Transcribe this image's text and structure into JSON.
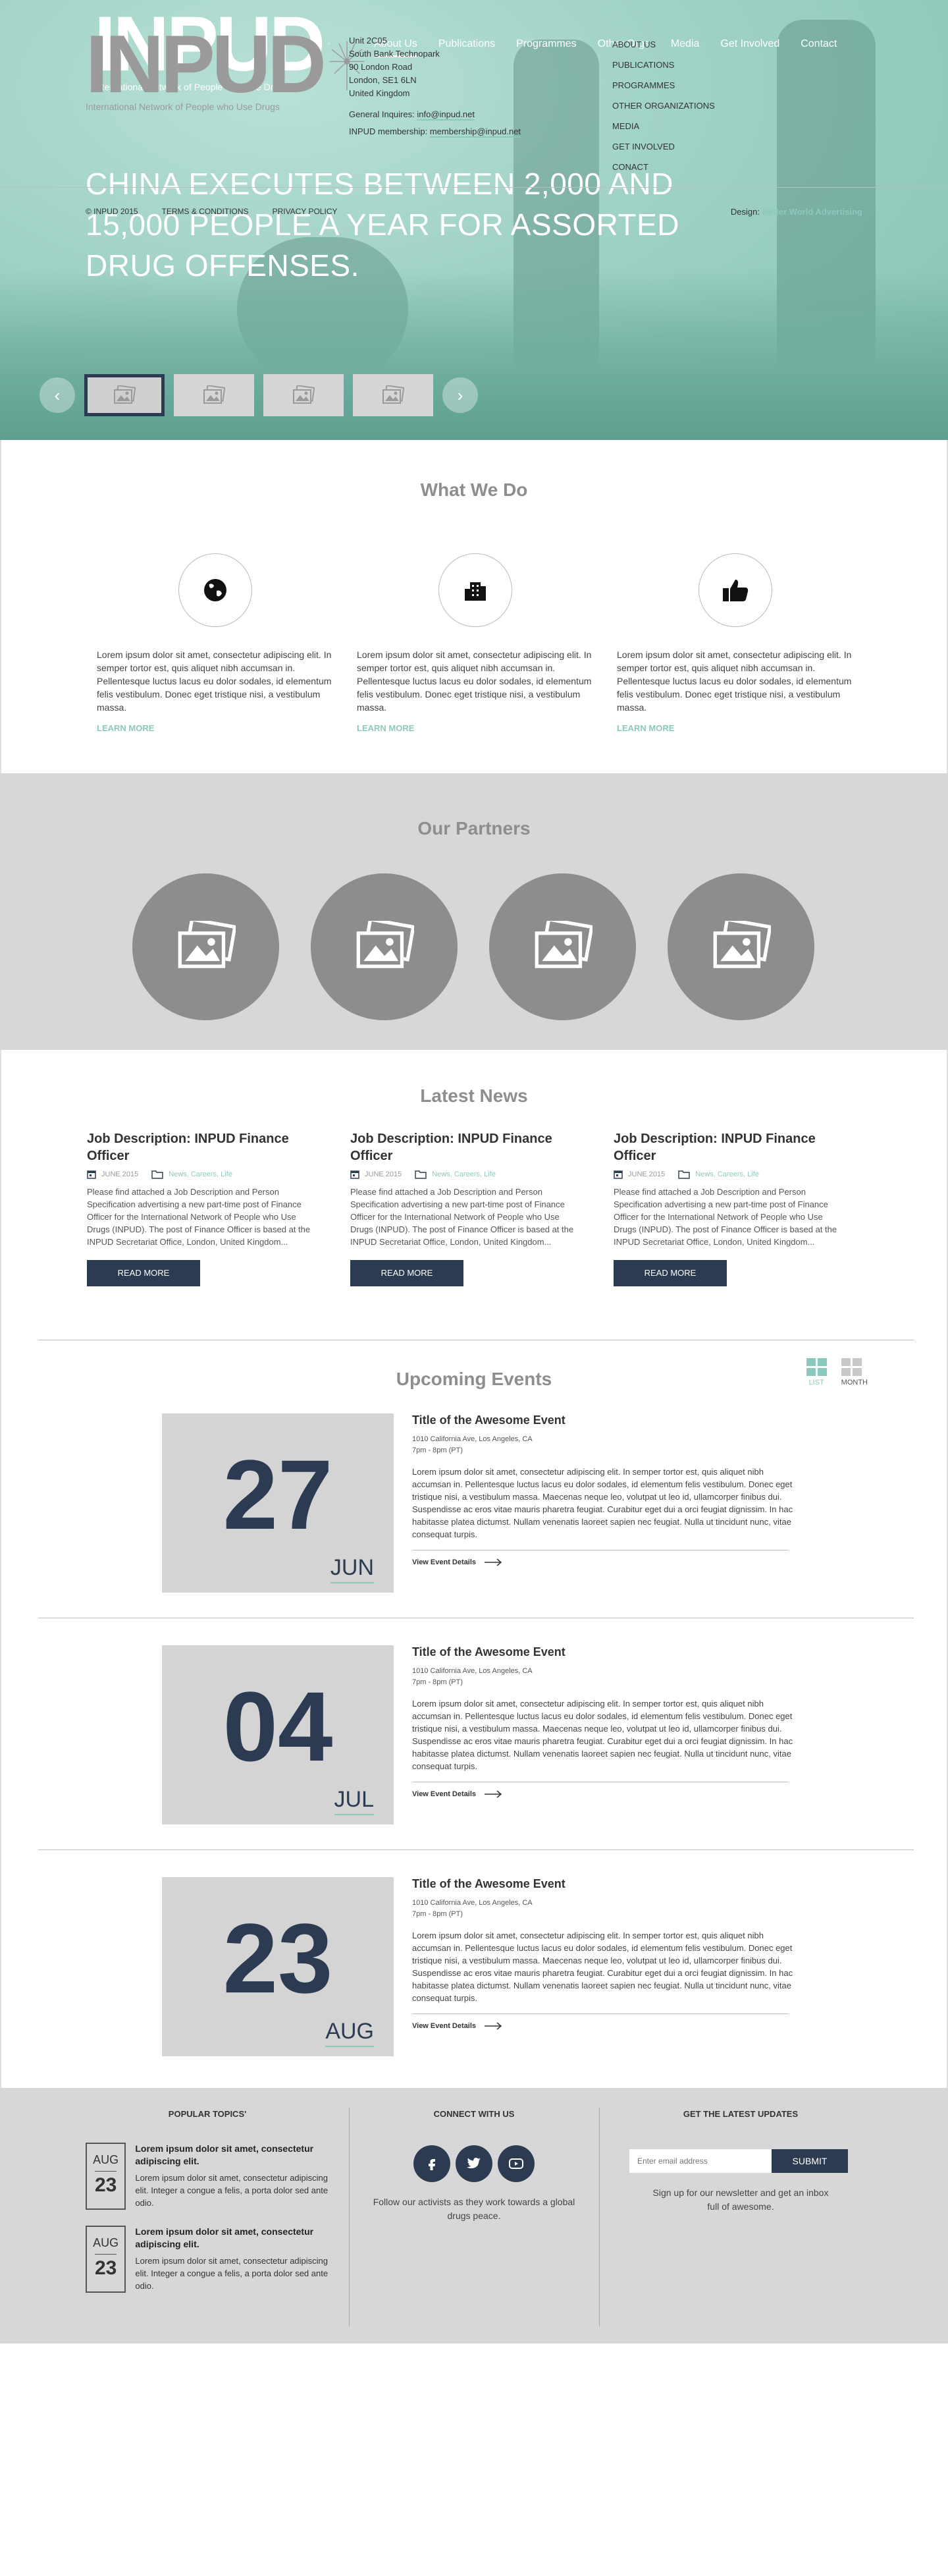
{
  "header": {
    "logo_text": "INPUD",
    "logo_sub": "International Network of People who Use Drugs",
    "nav": [
      "About Us",
      "Publications",
      "Programmes",
      "Other Orgs",
      "Media",
      "Get Involved",
      "Contact"
    ],
    "active_nav": "About Us"
  },
  "hero": {
    "headline": "CHINA EXECUTES BETWEEN 2,000 AND 15,000 PEOPLE A YEAR FOR ASSORTED DRUG OFFENSES.",
    "prev_arrow": "‹",
    "next_arrow": "›"
  },
  "what_we_do": {
    "title": "What We Do",
    "items": [
      {
        "icon": "globe-icon",
        "text": "Lorem ipsum dolor sit amet, consectetur adipiscing elit. In semper tortor est, quis aliquet nibh accumsan in. Pellentesque luctus lacus eu dolor sodales, id elementum felis vestibulum. Donec eget tristique nisi, a vestibulum massa.",
        "link": "LEARN MORE"
      },
      {
        "icon": "building-icon",
        "text": "Lorem ipsum dolor sit amet, consectetur adipiscing elit. In semper tortor est, quis aliquet nibh accumsan in. Pellentesque luctus lacus eu dolor sodales, id elementum felis vestibulum. Donec eget tristique nisi, a vestibulum massa.",
        "link": "LEARN MORE"
      },
      {
        "icon": "thumbs-up-icon",
        "text": "Lorem ipsum dolor sit amet, consectetur adipiscing elit. In semper tortor est, quis aliquet nibh accumsan in. Pellentesque luctus lacus eu dolor sodales, id elementum felis vestibulum. Donec eget tristique nisi, a vestibulum massa.",
        "link": "LEARN MORE"
      }
    ]
  },
  "partners": {
    "title": "Our Partners"
  },
  "news": {
    "title": "Latest News",
    "items": [
      {
        "title": "Job Description: INPUD Finance Officer",
        "date": "JUNE 2015",
        "tags": "News, Careers, Life",
        "body": "Please find attached a Job Description and Person Specification advertising a new part-time post of Finance Officer for the International Network of People who Use Drugs (INPUD).  The post of Finance Officer is based at the INPUD Secretariat Office, London, United Kingdom...",
        "button": "READ MORE"
      },
      {
        "title": "Job Description: INPUD Finance Officer",
        "date": "JUNE 2015",
        "tags": "News, Careers, Life",
        "body": "Please find attached a Job Description and Person Specification advertising a new part-time post of Finance Officer for the International Network of People who Use Drugs (INPUD).  The post of Finance Officer is based at the INPUD Secretariat Office, London, United Kingdom...",
        "button": "READ MORE"
      },
      {
        "title": "Job Description: INPUD Finance Officer",
        "date": "JUNE 2015",
        "tags": "News, Careers, Life",
        "body": "Please find attached a Job Description and Person Specification advertising a new part-time post of Finance Officer for the International Network of People who Use Drugs (INPUD).  The post of Finance Officer is based at the INPUD Secretariat Office, London, United Kingdom...",
        "button": "READ MORE"
      }
    ]
  },
  "events": {
    "title": "Upcoming Events",
    "view_list": "LIST",
    "view_month": "MONTH",
    "items": [
      {
        "day": "27",
        "month": "JUN",
        "title": "Title of the Awesome Event",
        "address": "1010 California Ave, Los Angeles, CA",
        "time": "7pm - 8pm (PT)",
        "body": "Lorem ipsum dolor sit amet, consectetur adipiscing elit. In semper tortor est, quis aliquet nibh accumsan in. Pellentesque luctus lacus eu dolor sodales, id elementum felis vestibulum. Donec eget tristique nisi, a vestibulum massa. Maecenas neque leo, volutpat ut leo id, ullamcorper finibus dui. Suspendisse ac eros vitae mauris pharetra feugiat. Curabitur eget dui a orci feugiat dignissim. In hac habitasse platea dictumst. Nullam venenatis laoreet sapien nec feugiat. Nulla ut tincidunt nunc, vitae consequat turpis.",
        "link": "View Event Details"
      },
      {
        "day": "04",
        "month": "JUL",
        "title": "Title of the Awesome Event",
        "address": "1010 California Ave, Los Angeles, CA",
        "time": "7pm - 8pm (PT)",
        "body": "Lorem ipsum dolor sit amet, consectetur adipiscing elit. In semper tortor est, quis aliquet nibh accumsan in. Pellentesque luctus lacus eu dolor sodales, id elementum felis vestibulum. Donec eget tristique nisi, a vestibulum massa. Maecenas neque leo, volutpat ut leo id, ullamcorper finibus dui. Suspendisse ac eros vitae mauris pharetra feugiat. Curabitur eget dui a orci feugiat dignissim. In hac habitasse platea dictumst. Nullam venenatis laoreet sapien nec feugiat. Nulla ut tincidunt nunc, vitae consequat turpis.",
        "link": "View Event Details"
      },
      {
        "day": "23",
        "month": "AUG",
        "title": "Title of the Awesome Event",
        "address": "1010 California Ave, Los Angeles, CA",
        "time": "7pm - 8pm (PT)",
        "body": "Lorem ipsum dolor sit amet, consectetur adipiscing elit. In semper tortor est, quis aliquet nibh accumsan in. Pellentesque luctus lacus eu dolor sodales, id elementum felis vestibulum. Donec eget tristique nisi, a vestibulum massa. Maecenas neque leo, volutpat ut leo id, ullamcorper finibus dui. Suspendisse ac eros vitae mauris pharetra feugiat. Curabitur eget dui a orci feugiat dignissim. In hac habitasse platea dictumst. Nullam venenatis laoreet sapien nec feugiat. Nulla ut tincidunt nunc, vitae consequat turpis.",
        "link": "View Event Details"
      }
    ]
  },
  "widgets": {
    "popular_title": "POPULAR TOPICS'",
    "topics": [
      {
        "month": "AUG",
        "day": "23",
        "heading": "Lorem ipsum dolor sit amet, consectetur adipiscing elit.",
        "text": "Lorem ipsum dolor sit amet, consectetur adipiscing elit. Integer a congue a felis, a porta dolor sed ante odio."
      },
      {
        "month": "AUG",
        "day": "23",
        "heading": "Lorem ipsum dolor sit amet, consectetur adipiscing elit.",
        "text": "Lorem ipsum dolor sit amet, consectetur adipiscing elit. Integer a congue a felis, a porta dolor sed ante odio."
      }
    ],
    "connect_title": "CONNECT WITH US",
    "connect_text": "Follow our activists as they work towards a global drugs peace.",
    "updates_title": "GET THE LATEST UPDATES",
    "email_placeholder": "Enter email address",
    "submit": "SUBMIT",
    "updates_text": "Sign up for our newsletter and get an inbox full of awesome."
  },
  "footer": {
    "logo_text": "INPUD",
    "logo_sub": "International Network of People who Use Drugs",
    "address": [
      "Unit 2C05",
      "South Bank Technopark",
      "90 London Road",
      "London, SE1 6LN",
      "United Kingdom"
    ],
    "general_label": "General Inquires:",
    "general_email": "info@inpud.net",
    "membership_label": "INPUD membership:",
    "membership_email": "membership@inpud.net",
    "links": [
      "ABOUT US",
      "PUBLICATIONS",
      "PROGRAMMES",
      "OTHER ORGANIZATIONS",
      "MEDIA",
      "GET INVOLVED",
      "CONACT"
    ],
    "copyright": "© INPUD 2015",
    "terms": "TERMS & CONDITIONS",
    "privacy": "PRIVACY POLICY",
    "design_label": "Design:",
    "design_by": "Better World Advertising"
  },
  "colors": {
    "navy": "#2d3b52",
    "teal": "#8cc9bd",
    "grey_bg": "#d7d7d7"
  }
}
